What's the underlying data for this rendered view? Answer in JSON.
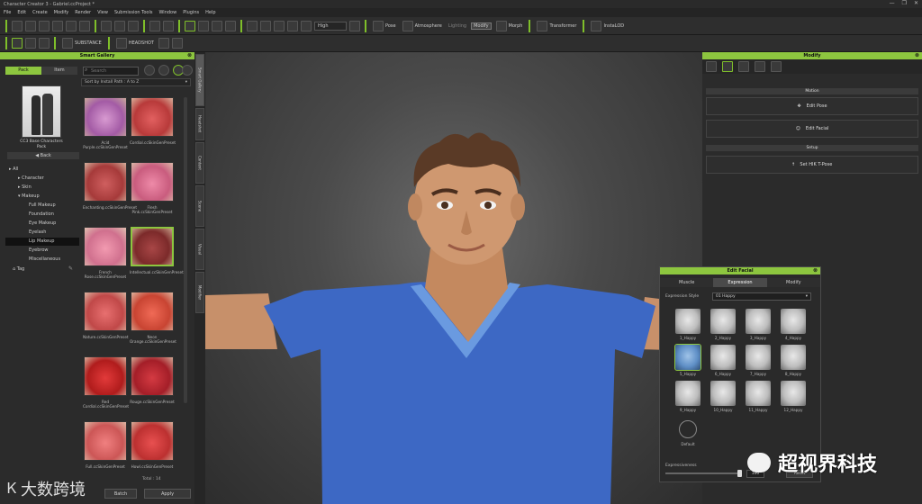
{
  "window": {
    "title": "Character Creator 3 - Gabriel.ccProject *",
    "controls": [
      "—",
      "❐",
      "✕"
    ]
  },
  "menu": [
    "File",
    "Edit",
    "Create",
    "Modify",
    "Render",
    "View",
    "Submission Tools",
    "Window",
    "Plugins",
    "Help"
  ],
  "toolbar": {
    "quality": "High",
    "pose_label": "Pose",
    "atmosphere_label": "Atmosphere",
    "lighting_label": "Lighting",
    "modify_label": "Modify",
    "morph_label": "Morph",
    "transformer_label": "Transformer",
    "instalod_label": "InstaLOD",
    "headshot_label": "HEADSHOT",
    "substance_label": "SUBSTANCE"
  },
  "smart_gallery": {
    "title": "Smart Gallery",
    "tabs": [
      "Pack",
      "Item"
    ],
    "search_placeholder": "Search",
    "pack_name": "CC3 Base Characters Pack",
    "back_label": "Back",
    "sort_label": "Sort by Install Path : A to Z",
    "tree": [
      "All",
      "Character",
      "Skin",
      "Makeup",
      "Full Makeup",
      "Foundation",
      "Eye Makeup",
      "Eyelash",
      "Lip Makeup",
      "Eyebrow",
      "Miscellaneous"
    ],
    "tag_label": "Tag",
    "items": [
      {
        "caption": "Acid Purple.ccSkinGenPreset"
      },
      {
        "caption": "Cordial.ccSkinGenPreset"
      },
      {
        "caption": "Enchanting.ccSkinGenPreset"
      },
      {
        "caption": "Flesh Pink.ccSkinGenPreset"
      },
      {
        "caption": "French Rose.ccSkinGenPreset"
      },
      {
        "caption": "Intellectual.ccSkinGenPreset"
      },
      {
        "caption": "Nature.ccSkinGenPreset"
      },
      {
        "caption": "Neon Orange.ccSkinGenPreset"
      },
      {
        "caption": "Red Cordial.ccSkinGenPreset"
      },
      {
        "caption": "Rouge.ccSkinGenPreset"
      },
      {
        "caption": "Full.ccSkinGenPreset"
      },
      {
        "caption": "Howl.ccSkinGenPreset"
      }
    ],
    "total_label": "Total : 14",
    "apply_label": "Apply",
    "batch_label": "Batch"
  },
  "side_tabs": [
    "Smart Gallery",
    "Headshot",
    "Content",
    "Scene",
    "Visual",
    "Modifier"
  ],
  "modify_panel": {
    "title": "Modify",
    "section_motion": "Motion",
    "edit_pose": "Edit Pose",
    "edit_facial": "Edit Facial",
    "section_setup": "Setup",
    "set_hik": "Set HIK T-Pose"
  },
  "edit_facial": {
    "title": "Edit Facial",
    "tabs": [
      "Muscle",
      "Expression",
      "Modify"
    ],
    "style_label": "Expression Style",
    "style_value": "01 Happy",
    "faces": [
      "1_Happy",
      "2_Happy",
      "3_Happy",
      "4_Happy",
      "5_Happy",
      "6_Happy",
      "7_Happy",
      "8_Happy",
      "9_Happy",
      "10_Happy",
      "11_Happy",
      "12_Happy"
    ],
    "default_label": "Default",
    "strength_label": "Expressiveness",
    "strength_value": "100",
    "reset_label": "Reset"
  },
  "watermark": {
    "left": "大数跨境",
    "right": "超视界科技"
  },
  "colors": {
    "accent": "#8dc63f",
    "shirt": "#3d68c4"
  }
}
